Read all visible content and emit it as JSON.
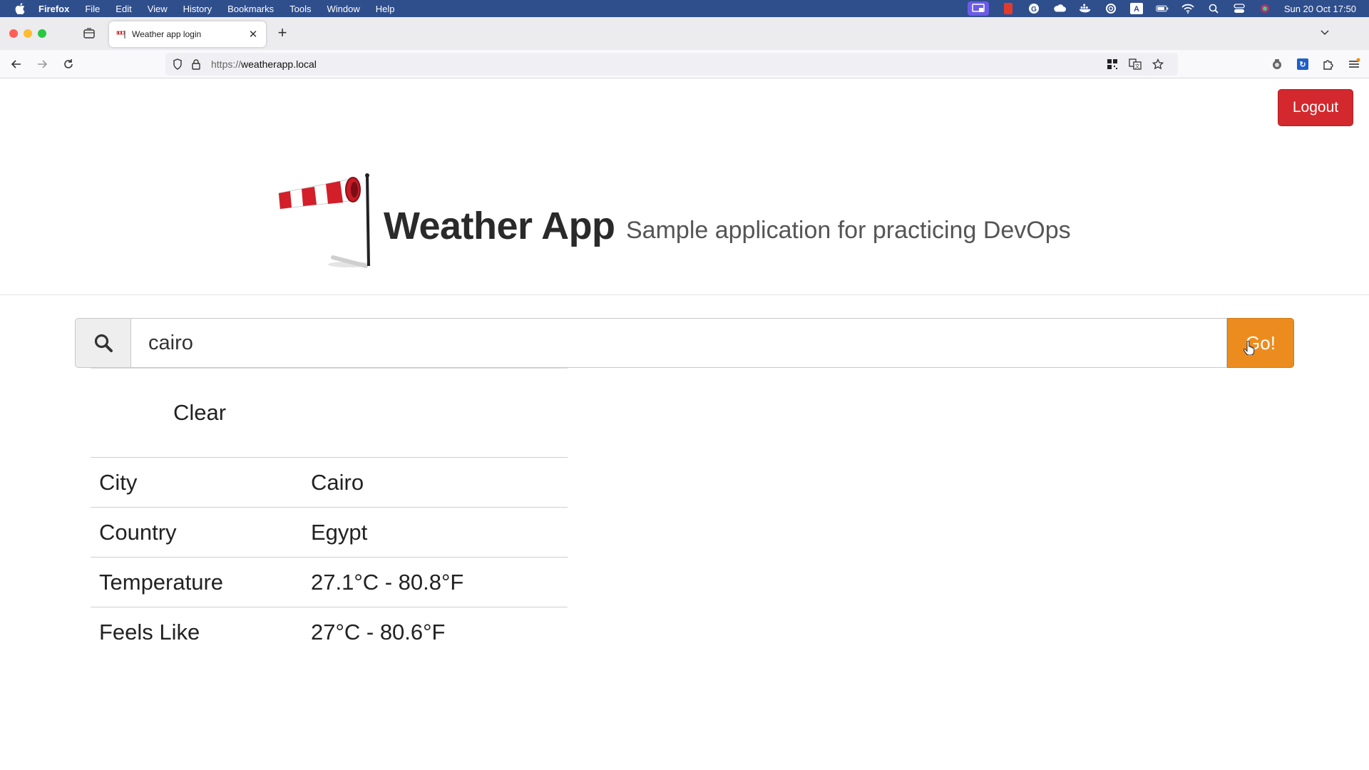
{
  "menubar": {
    "app_name": "Firefox",
    "items": [
      "File",
      "Edit",
      "View",
      "History",
      "Bookmarks",
      "Tools",
      "Window",
      "Help"
    ],
    "clock": "Sun 20 Oct  17:50",
    "tray_icons": [
      "screen-share-icon",
      "stop-record-icon",
      "grammarly-icon",
      "cloud-icon",
      "docker-icon",
      "creative-cloud-icon",
      "input-source-icon",
      "battery-icon",
      "wifi-icon",
      "spotlight-icon",
      "control-center-icon",
      "siri-icon"
    ],
    "input_source_label": "A"
  },
  "browser": {
    "tab_title": "Weather app login",
    "url_scheme": "https://",
    "url_host": "weatherapp.local"
  },
  "page": {
    "logout_label": "Logout",
    "title": "Weather App",
    "subtitle": "Sample application for practicing DevOps",
    "search": {
      "value": "cairo",
      "go_label": "Go!"
    },
    "result": {
      "condition": "Clear",
      "rows": [
        {
          "key": "City",
          "value": "Cairo"
        },
        {
          "key": "Country",
          "value": "Egypt"
        },
        {
          "key": "Temperature",
          "value": "27.1°C - 80.8°F"
        },
        {
          "key": "Feels Like",
          "value": "27°C - 80.6°F"
        }
      ]
    }
  },
  "colors": {
    "logout": "#d3282d",
    "go": "#ec8c1e",
    "menubar": "#2f4e8c"
  }
}
